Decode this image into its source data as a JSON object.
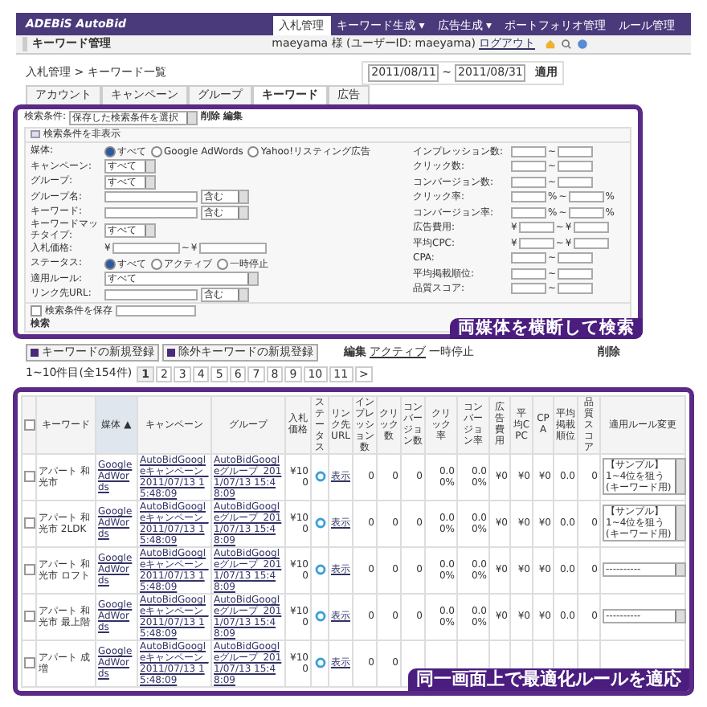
{
  "header": {
    "logo": "ADEBiS AutoBid",
    "nav": [
      {
        "label": "入札管理",
        "selected": true
      },
      {
        "label": "キーワード生成 ▾",
        "selected": false
      },
      {
        "label": "広告生成 ▾",
        "selected": false
      },
      {
        "label": "ポートフォリオ管理",
        "selected": false
      },
      {
        "label": "ルール管理",
        "selected": false
      }
    ]
  },
  "subheader": {
    "title": "キーワード管理",
    "user": "maeyama 様 (ユーザーID: maeyama)",
    "logout": "ログアウト"
  },
  "breadcrumb": "入札管理 > キーワード一覧",
  "date_range": {
    "from": "2011/08/11",
    "separator": "~",
    "to": "2011/08/31",
    "apply": "適用"
  },
  "tabs": [
    {
      "label": "アカウント",
      "selected": false
    },
    {
      "label": "キャンペーン",
      "selected": false
    },
    {
      "label": "グループ",
      "selected": false
    },
    {
      "label": "キーワード",
      "selected": true
    },
    {
      "label": "広告",
      "selected": false
    }
  ],
  "filter": {
    "saved_label": "検索条件:",
    "saved_select": "保存した検索条件を選択",
    "delete": "削除",
    "edit": "編集",
    "toggle": "検索条件を非表示",
    "left_fields": [
      {
        "label": "媒体:",
        "kind": "radio",
        "options": [
          {
            "label": "すべて",
            "selected": true
          },
          {
            "label": "Google AdWords",
            "selected": false
          },
          {
            "label": "Yahoo!リスティング広告",
            "selected": false
          }
        ]
      },
      {
        "label": "キャンペーン:",
        "kind": "select",
        "value": "すべて"
      },
      {
        "label": "グループ:",
        "kind": "select",
        "value": "すべて"
      },
      {
        "label": "グループ名:",
        "kind": "match",
        "match": "含む"
      },
      {
        "label": "キーワード:",
        "kind": "match",
        "match": "含む"
      },
      {
        "label": "キーワードマッチタイプ:",
        "kind": "select",
        "value": "すべて"
      },
      {
        "label": "入札価格:",
        "kind": "price",
        "currency": "¥",
        "separator": "~"
      },
      {
        "label": "ステータス:",
        "kind": "radio",
        "options": [
          {
            "label": "すべて",
            "selected": true
          },
          {
            "label": "アクティブ",
            "selected": false
          },
          {
            "label": "一時停止",
            "selected": false
          }
        ]
      },
      {
        "label": "適用ルール:",
        "kind": "wide",
        "value": "すべて"
      },
      {
        "label": "リンク先URL:",
        "kind": "match",
        "match": "含む"
      }
    ],
    "right_fields": [
      {
        "label": "インプレッション数:",
        "separator": "~"
      },
      {
        "label": "クリック数:",
        "separator": "~"
      },
      {
        "label": "コンバージョン数:",
        "separator": "~"
      },
      {
        "label": "クリック率:",
        "separator": "~",
        "unit": "%"
      },
      {
        "label": "コンバージョン率:",
        "separator": "~",
        "unit": "%"
      },
      {
        "label": "広告費用:",
        "separator": "~",
        "currency": "¥"
      },
      {
        "label": "平均CPC:",
        "separator": "~",
        "currency": "¥"
      },
      {
        "label": "CPA:",
        "separator": "~"
      },
      {
        "label": "平均掲載順位:",
        "separator": "~"
      },
      {
        "label": "品質スコア:",
        "separator": "~"
      }
    ],
    "save": {
      "label": "検索条件を保存",
      "checked": false
    },
    "search": "検索",
    "banner": "両媒体を横断して検索"
  },
  "actions": {
    "new_keyword": "キーワードの新規登録",
    "new_negative": "除外キーワードの新規登録",
    "edit": "編集",
    "active": "アクティブ",
    "pause": "一時停止",
    "delete": "削除"
  },
  "pagination": {
    "summary": "1~10件目(全154件)",
    "pages": [
      {
        "label": "1",
        "selected": true
      },
      {
        "label": "2",
        "selected": false
      },
      {
        "label": "3",
        "selected": false
      },
      {
        "label": "4",
        "selected": false
      },
      {
        "label": "5",
        "selected": false
      },
      {
        "label": "6",
        "selected": false
      },
      {
        "label": "7",
        "selected": false
      },
      {
        "label": "8",
        "selected": false
      },
      {
        "label": "9",
        "selected": false
      },
      {
        "label": "10",
        "selected": false
      },
      {
        "label": "11",
        "selected": false
      },
      {
        "label": ">",
        "selected": false
      }
    ]
  },
  "table": {
    "select_all": {
      "checked": false
    },
    "columns": [
      {
        "label": "キーワード",
        "sorted": false
      },
      {
        "label": "媒体 ▲",
        "sorted": true
      },
      {
        "label": "キャンペーン",
        "sorted": false
      },
      {
        "label": "グループ",
        "sorted": false
      },
      {
        "label": "入札価格",
        "sorted": false
      },
      {
        "label": "ステータス",
        "sorted": false
      },
      {
        "label": "リンク先URL",
        "sorted": false
      },
      {
        "label": "インプレッション数",
        "sorted": false
      },
      {
        "label": "クリック数",
        "sorted": false
      },
      {
        "label": "コンバージョン数",
        "sorted": false
      },
      {
        "label": "クリック率",
        "sorted": false
      },
      {
        "label": "コンバージョン率",
        "sorted": false
      },
      {
        "label": "広告費用",
        "sorted": false
      },
      {
        "label": "平均CPC",
        "sorted": false
      },
      {
        "label": "CPA",
        "sorted": false
      },
      {
        "label": "平均掲載順位",
        "sorted": false
      },
      {
        "label": "品質スコア",
        "sorted": false
      },
      {
        "label": "適用ルール変更",
        "sorted": false
      }
    ],
    "rows": [
      {
        "checked": false,
        "active": true,
        "cells": [
          "アパート 和光市",
          "Google AdWords",
          "AutoBidGoogleキャンペーン_2011/07/13 15:48:09",
          "AutoBidGoogleグループ_2011/07/13 15:48:09",
          "¥100",
          "",
          "表示",
          "0",
          "0",
          "0",
          "0.00%",
          "0.00%",
          "¥0",
          "¥0",
          "¥0",
          "0.0",
          "0"
        ],
        "rule": "【サンプル】1~4位を狙う(キーワード用)"
      },
      {
        "checked": false,
        "active": true,
        "cells": [
          "アパート 和光市 2LDK",
          "Google AdWords",
          "AutoBidGoogleキャンペーン_2011/07/13 15:48:09",
          "AutoBidGoogleグループ_2011/07/13 15:48:09",
          "¥100",
          "",
          "表示",
          "0",
          "0",
          "0",
          "0.00%",
          "0.00%",
          "¥0",
          "¥0",
          "¥0",
          "0.0",
          "0"
        ],
        "rule": "【サンプル】1~4位を狙う(キーワード用)"
      },
      {
        "checked": false,
        "active": true,
        "cells": [
          "アパート 和光市 ロフト",
          "Google AdWords",
          "AutoBidGoogleキャンペーン_2011/07/13 15:48:09",
          "AutoBidGoogleグループ_2011/07/13 15:48:09",
          "¥100",
          "",
          "表示",
          "0",
          "0",
          "0",
          "0.00%",
          "0.00%",
          "¥0",
          "¥0",
          "¥0",
          "0.0",
          "0"
        ],
        "rule": "----------"
      },
      {
        "checked": false,
        "active": true,
        "cells": [
          "アパート 和光市 最上階",
          "Google AdWords",
          "AutoBidGoogleキャンペーン_2011/07/13 15:48:09",
          "AutoBidGoogleグループ_2011/07/13 15:48:09",
          "¥100",
          "",
          "表示",
          "0",
          "0",
          "0",
          "0.00%",
          "0.00%",
          "¥0",
          "¥0",
          "¥0",
          "0.0",
          "0"
        ],
        "rule": "----------"
      },
      {
        "checked": false,
        "active": true,
        "cells": [
          "アパート 成増",
          "Google AdWords",
          "AutoBidGoogleキャンペーン_2011/07/13 15:48:09",
          "AutoBidGoogleグループ_2011/07/13 15:48:09",
          "¥100",
          "",
          "表示",
          "0",
          "0"
        ]
      }
    ],
    "banner": "同一画面上で最適化ルールを適応"
  }
}
